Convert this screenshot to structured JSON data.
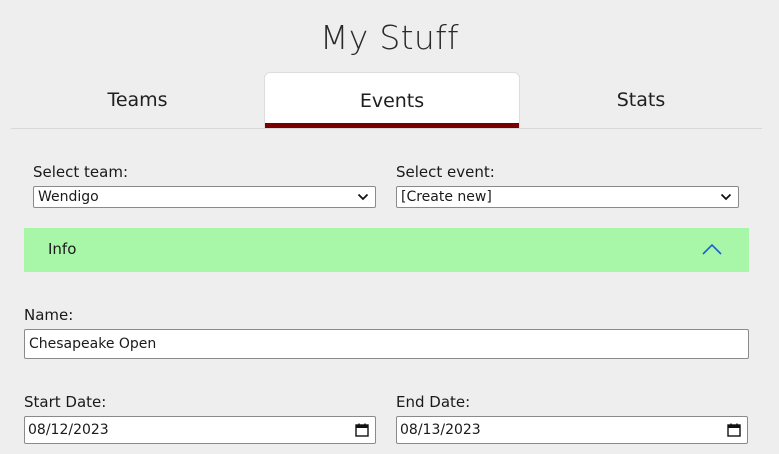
{
  "header": {
    "title": "My Stuff"
  },
  "tabs": [
    {
      "label": "Teams",
      "active": false
    },
    {
      "label": "Events",
      "active": true
    },
    {
      "label": "Stats",
      "active": false
    }
  ],
  "selectors": {
    "team": {
      "label": "Select team:",
      "value": "Wendigo"
    },
    "event": {
      "label": "Select event:",
      "value": "[Create new]"
    }
  },
  "info_section": {
    "title": "Info",
    "expanded": true,
    "color": "#a8f7a8"
  },
  "form": {
    "name": {
      "label": "Name:",
      "value": "Chesapeake Open"
    },
    "start_date": {
      "label": "Start Date:",
      "value": "08/12/2023"
    },
    "end_date": {
      "label": "End Date:",
      "value": "08/13/2023"
    }
  },
  "colors": {
    "active_tab_underline": "#7a0000",
    "background": "#eeeeee"
  },
  "icons": {
    "select_arrow": "chevron-down-icon",
    "accordion_toggle": "chevron-up-icon",
    "date_picker": "calendar-icon"
  }
}
